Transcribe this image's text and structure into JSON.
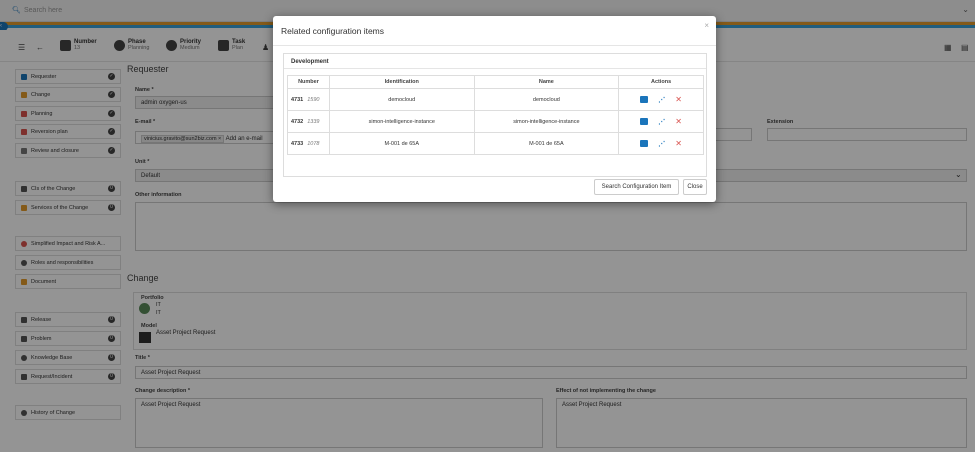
{
  "search": {
    "placeholder": "Search here"
  },
  "toolbar": {
    "number_label": "Number",
    "number_value": "13",
    "phase_label": "Phase",
    "phase_value": "Planning",
    "priority_label": "Priority",
    "priority_value": "Medium",
    "task_label": "Task",
    "task_value": "Plan"
  },
  "sidebar": {
    "items": [
      {
        "label": "Requester",
        "color": "#1b75bb"
      },
      {
        "label": "Change",
        "color": "#e49b2c"
      },
      {
        "label": "Planning",
        "color": "#d9534f"
      },
      {
        "label": "Reversion plan",
        "color": "#d9534f"
      },
      {
        "label": "Review and closure",
        "color": "#777777"
      },
      {
        "label": "CIs of the Change",
        "color": "#555555"
      },
      {
        "label": "Services of the Change",
        "color": "#e49b2c"
      },
      {
        "label": "Simplified Impact and Risk A...",
        "color": "#d9534f"
      },
      {
        "label": "Roles and responsibilities",
        "color": "#555555"
      },
      {
        "label": "Document",
        "color": "#e49b2c"
      },
      {
        "label": "Release",
        "color": "#555555"
      },
      {
        "label": "Problem",
        "color": "#555555"
      },
      {
        "label": "Knowledge Base",
        "color": "#555555"
      },
      {
        "label": "Request/Incident",
        "color": "#555555"
      },
      {
        "label": "History of Change",
        "color": "#555555"
      }
    ]
  },
  "requester": {
    "section_title": "Requester",
    "name_label": "Name *",
    "name_value": "admin oxygen-us",
    "email_label": "E-mail *",
    "email_tag": "vinicius.gravito@sun2biz.com ×",
    "email_add": "Add an e-mail",
    "extension_label": "Extension",
    "unit_label": "Unit *",
    "unit_value": "Default",
    "other_info_label": "Other information"
  },
  "change": {
    "section_title": "Change",
    "portfolio_label": "Portfolio",
    "portfolio_value1": "IT",
    "portfolio_value2": "IT",
    "model_label": "Model",
    "model_value": "Asset Project Request",
    "title_label": "Title *",
    "title_value": "Asset Project Request",
    "description_label": "Change description *",
    "description_value": "Asset Project Request",
    "effect_label": "Effect of not implementing the change",
    "effect_value": "Asset Project Request"
  },
  "modal": {
    "title": "Related configuration items",
    "close_glyph": "×",
    "panel_title": "Development",
    "columns": [
      "Number",
      "Identification",
      "Name",
      "Actions"
    ],
    "rows": [
      {
        "id": "4731",
        "code": "1590",
        "identification": "democloud",
        "name": "democloud"
      },
      {
        "id": "4732",
        "code": "1339",
        "identification": "simon-intelligence-instance",
        "name": "simon-intelligence-instance"
      },
      {
        "id": "4733",
        "code": "1078",
        "identification": "M-001 de 65A",
        "name": "M-001 de 65A"
      }
    ],
    "search_button": "Search Configuration Item",
    "close_button": "Close"
  }
}
